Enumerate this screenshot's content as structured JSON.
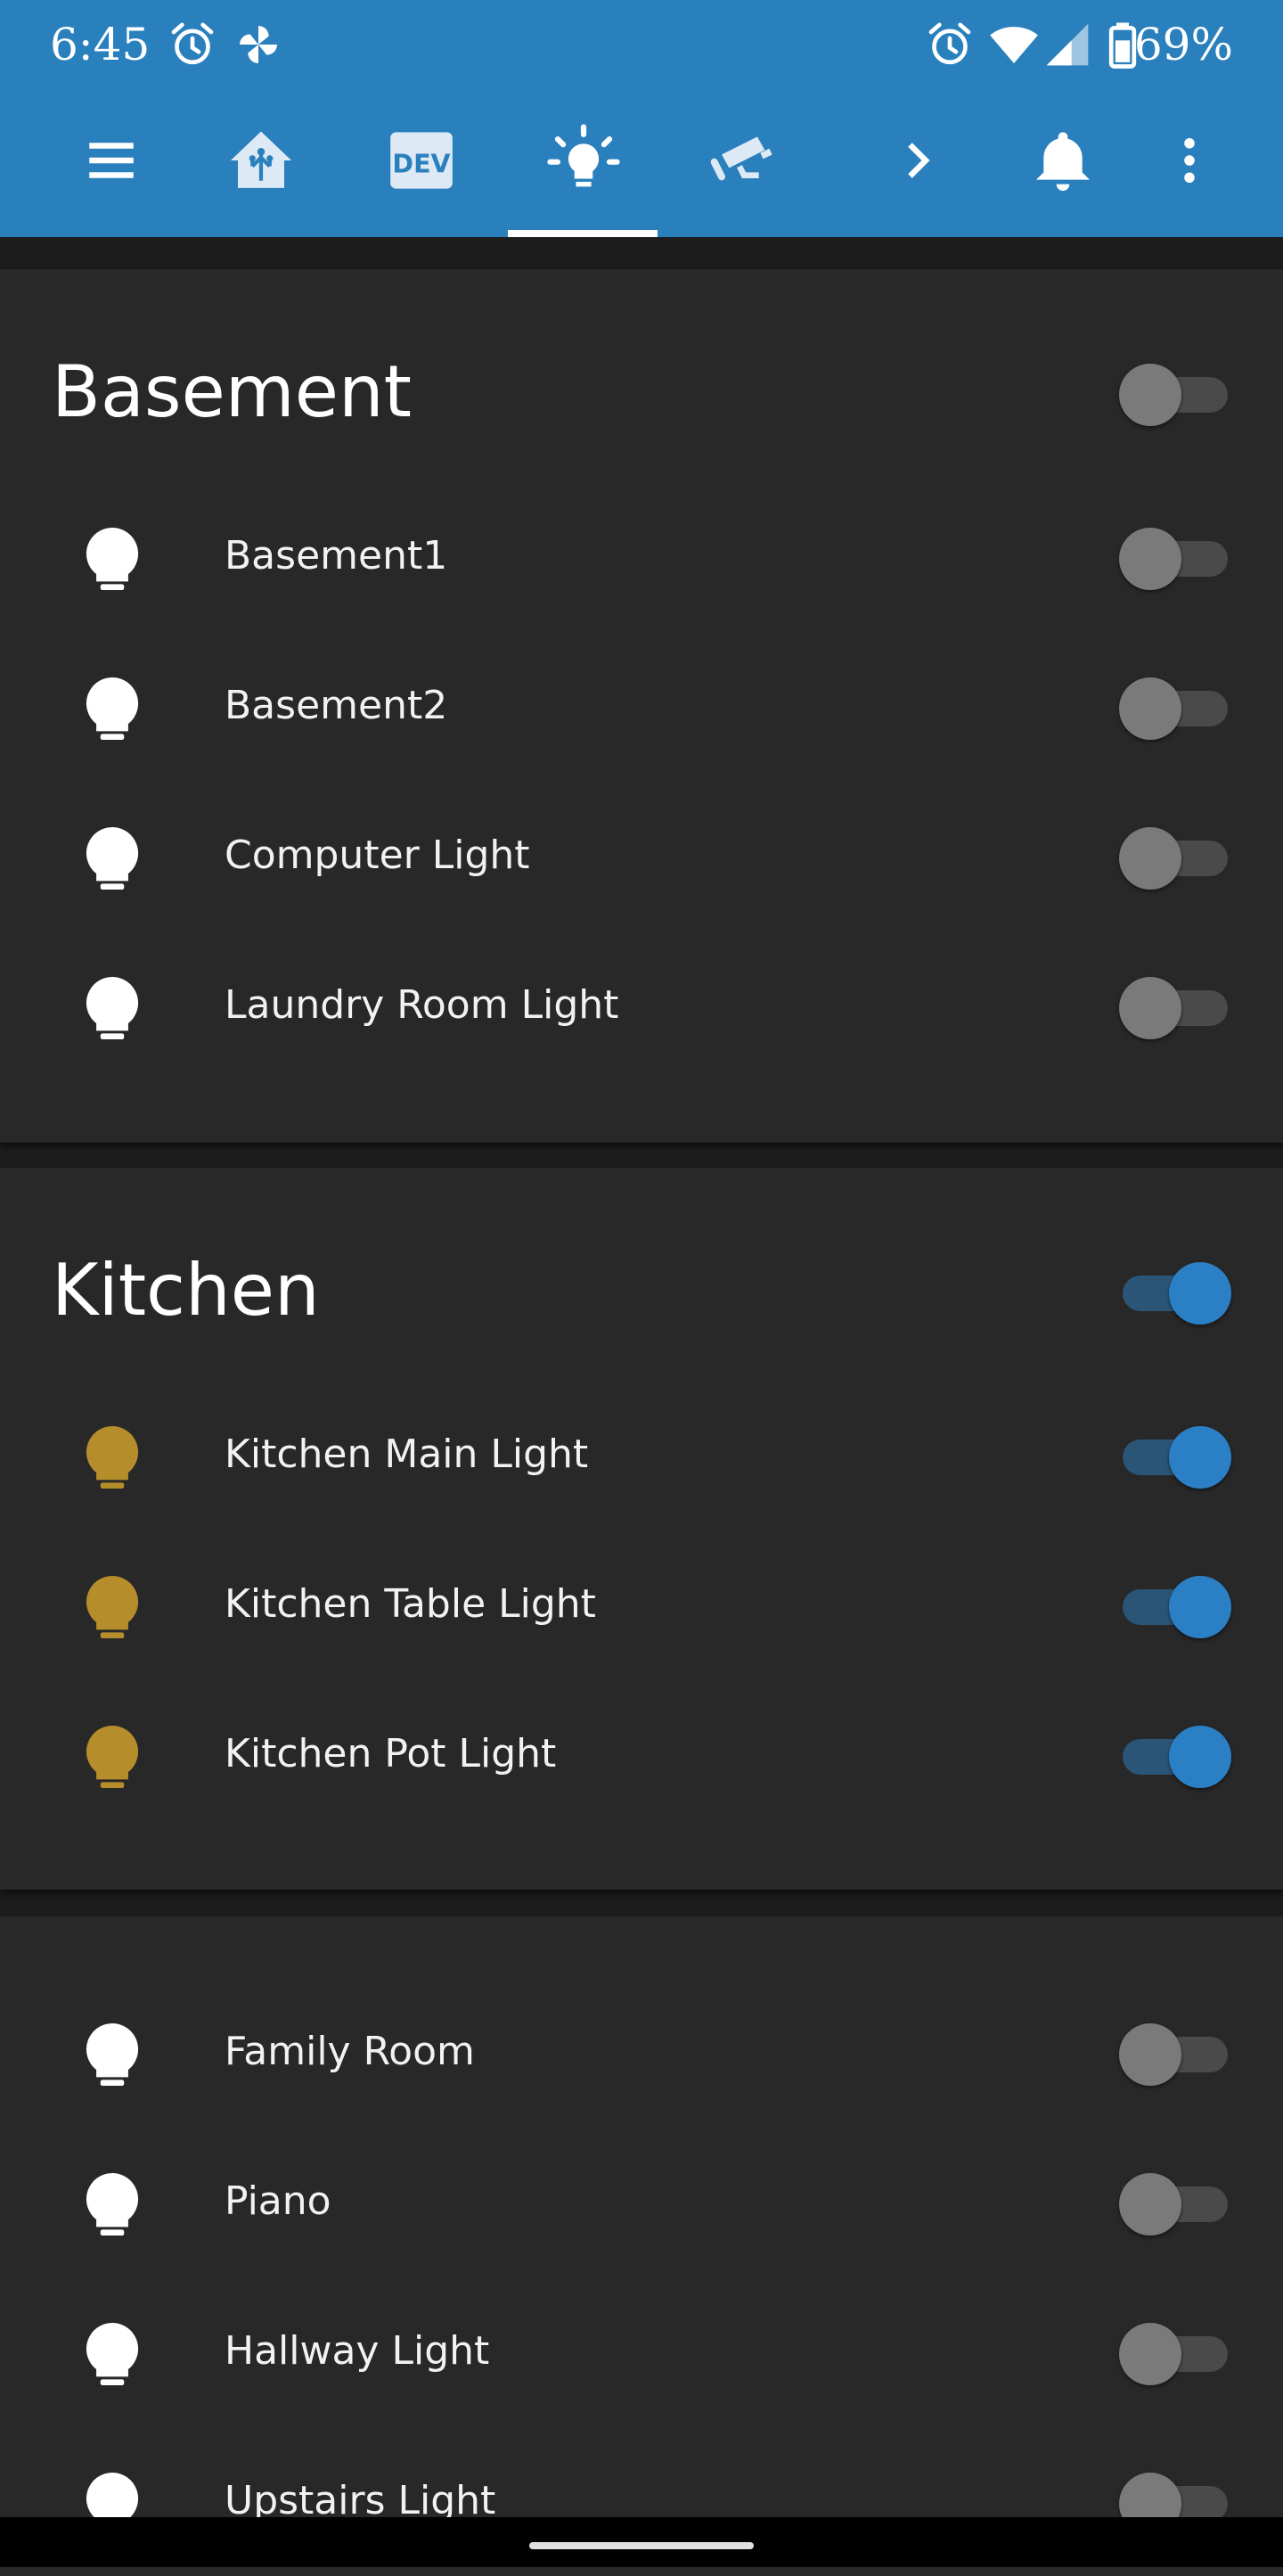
{
  "status_bar": {
    "time": "6:45",
    "battery_percent": "69%",
    "icons": [
      "alarm-icon",
      "pinwheel-icon",
      "alarm-icon",
      "wifi-icon",
      "cell-signal-icon",
      "battery-icon"
    ]
  },
  "toolbar": {
    "tabs": [
      {
        "name": "menu-icon"
      },
      {
        "name": "home-assistant-icon"
      },
      {
        "name": "dev-icon",
        "text": "DEV"
      },
      {
        "name": "lightbulb-icon",
        "active": true
      },
      {
        "name": "security-camera-icon"
      },
      {
        "name": "chevron-right-icon"
      },
      {
        "name": "bell-icon"
      },
      {
        "name": "more-vert-icon"
      }
    ]
  },
  "colors": {
    "accent": "#2980bd",
    "toggle_on": "#2b80c5",
    "bulb_on": "#b58d2b",
    "bulb_off": "#ffffff",
    "card": "#282828",
    "background": "#1c1c1c"
  },
  "cards": [
    {
      "title": "Basement",
      "master_on": false,
      "items": [
        {
          "label": "Basement1",
          "on": false
        },
        {
          "label": "Basement2",
          "on": false
        },
        {
          "label": "Computer Light",
          "on": false
        },
        {
          "label": "Laundry Room Light",
          "on": false
        }
      ]
    },
    {
      "title": "Kitchen",
      "master_on": true,
      "items": [
        {
          "label": "Kitchen Main Light",
          "on": true
        },
        {
          "label": "Kitchen Table Light",
          "on": true
        },
        {
          "label": "Kitchen Pot Light",
          "on": true
        }
      ]
    },
    {
      "title": "",
      "items": [
        {
          "label": "Family Room",
          "on": false
        },
        {
          "label": "Piano",
          "on": false
        },
        {
          "label": "Hallway Light",
          "on": false
        },
        {
          "label": "Upstairs Light",
          "on": false
        }
      ]
    }
  ]
}
